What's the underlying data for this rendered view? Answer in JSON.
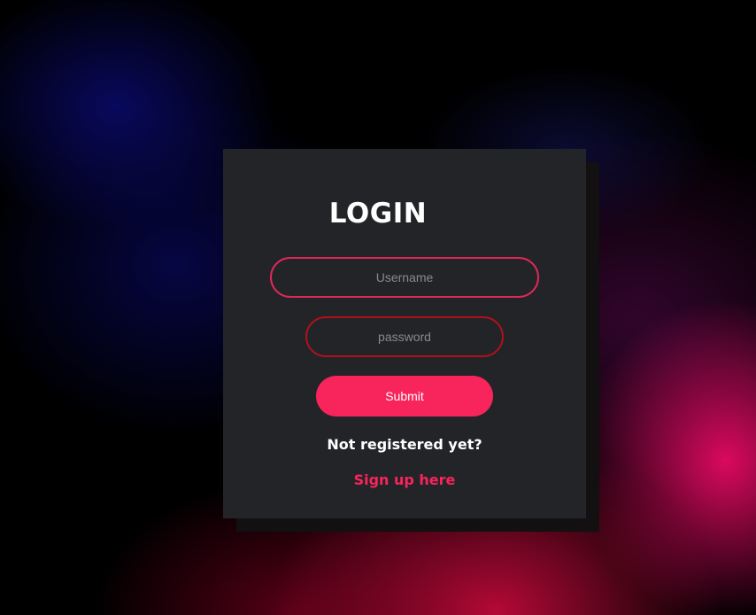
{
  "login": {
    "title": "LOGIN",
    "username": {
      "value": "",
      "placeholder": "Username"
    },
    "password": {
      "value": "",
      "placeholder": "password"
    },
    "submit_label": "Submit",
    "not_registered_text": "Not registered yet?",
    "signup_link_label": "Sign up here"
  },
  "colors": {
    "card_background": "#232428",
    "accent": "#f8245c",
    "username_border": "#e02858",
    "password_border": "#b0101e"
  }
}
